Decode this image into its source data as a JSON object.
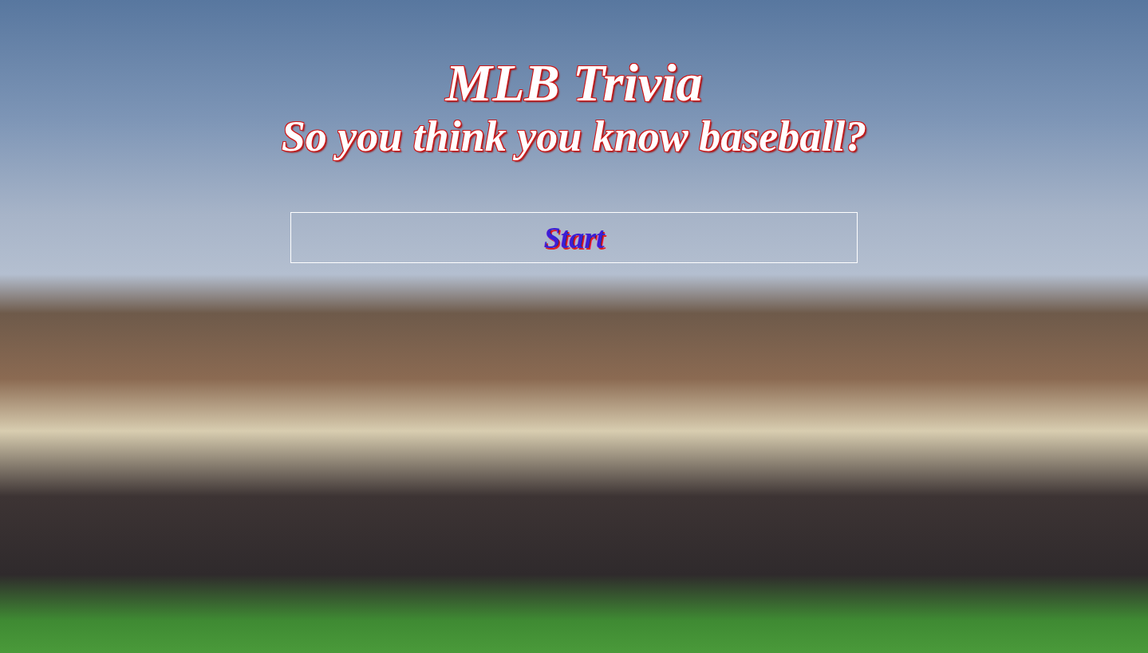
{
  "title": "MLB Trivia",
  "subtitle": "So you think you know baseball?",
  "start_button": {
    "label": "Start"
  }
}
